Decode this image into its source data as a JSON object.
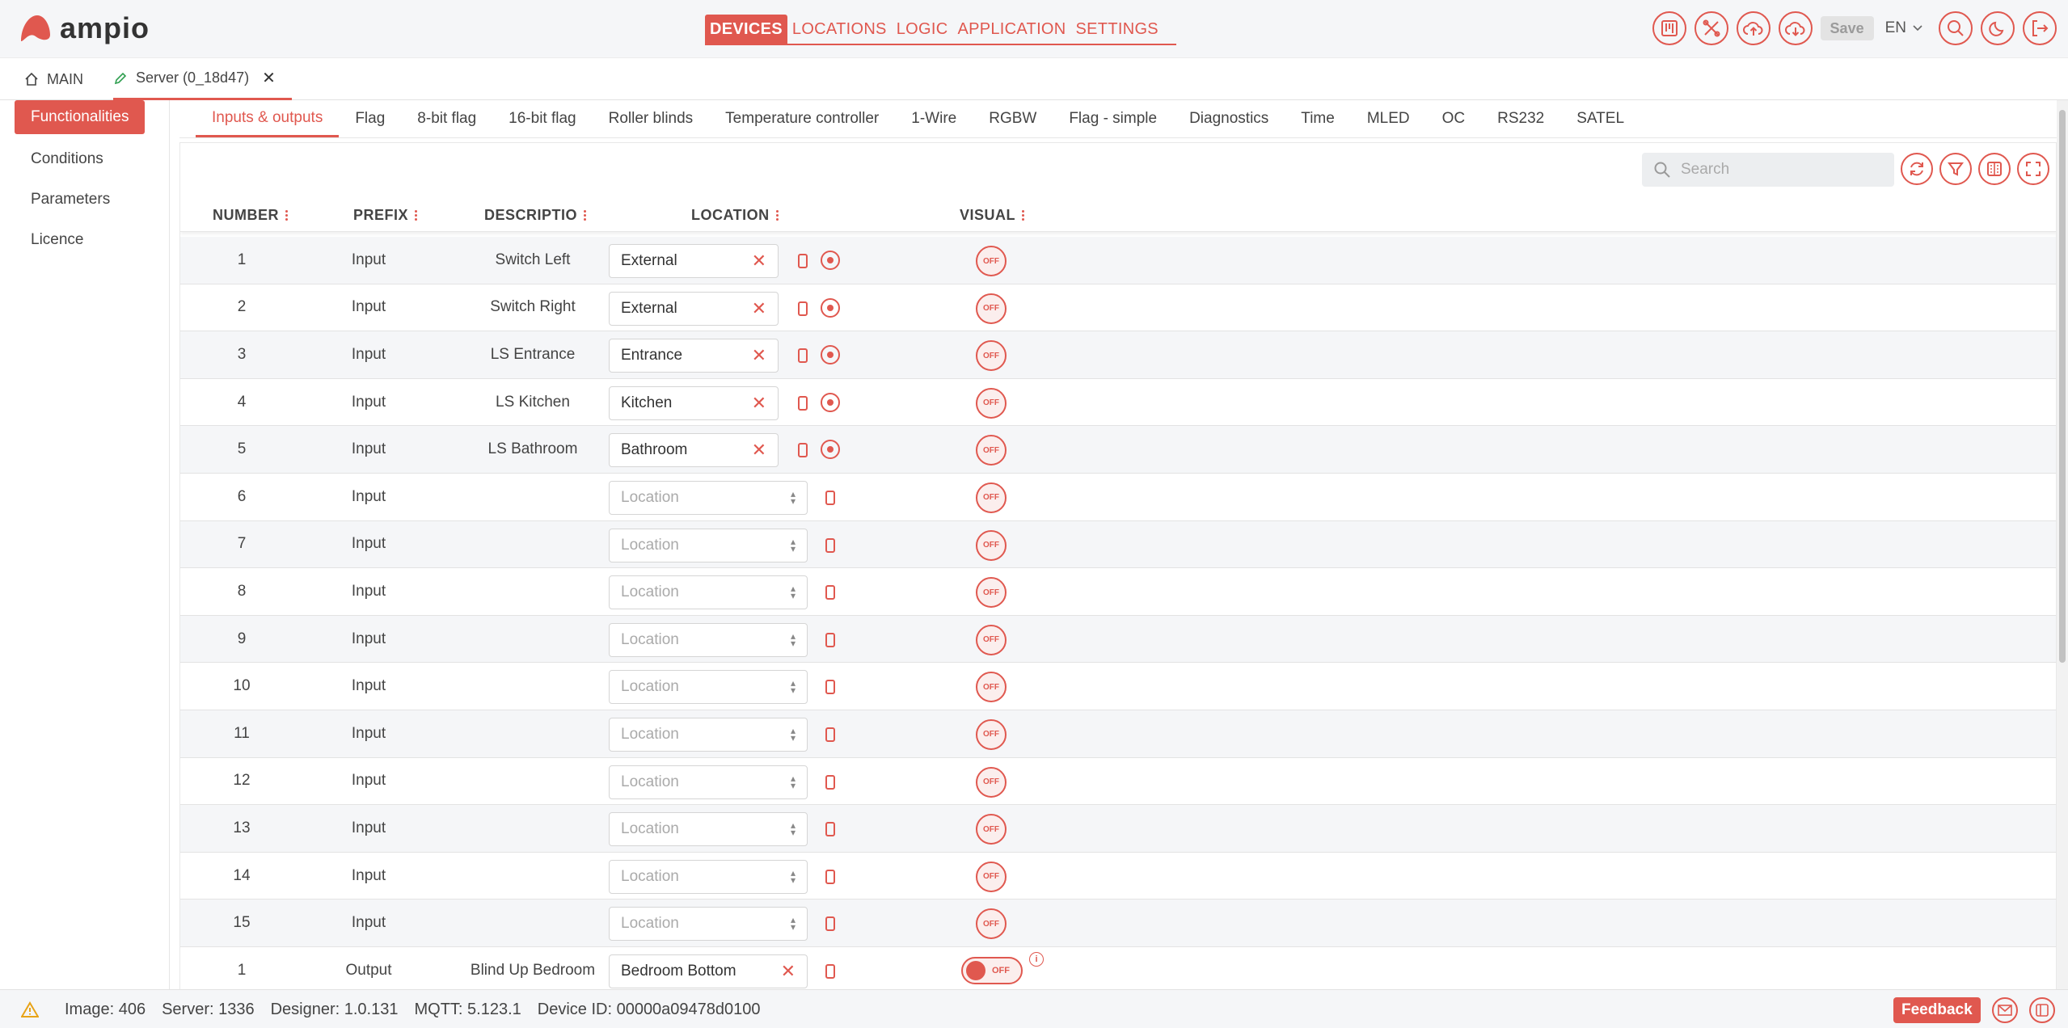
{
  "colors": {
    "accent": "#e0584f",
    "header_bg": "#f5f6f8",
    "stripe": "#f5f6f8"
  },
  "header": {
    "logo_text": "ampio",
    "nav": [
      {
        "label": "DEVICES",
        "active": true
      },
      {
        "label": "LOCATIONS",
        "active": false
      },
      {
        "label": "LOGIC",
        "active": false
      },
      {
        "label": "APPLICATION",
        "active": false
      },
      {
        "label": "SETTINGS",
        "active": false
      }
    ],
    "save_label": "Save",
    "language": "EN"
  },
  "page_tabs": {
    "main": "MAIN",
    "server": "Server (0_18d47)",
    "close": "✕"
  },
  "sidebar": {
    "items": [
      {
        "label": "Functionalities",
        "active": true
      },
      {
        "label": "Conditions",
        "active": false
      },
      {
        "label": "Parameters",
        "active": false
      },
      {
        "label": "Licence",
        "active": false
      }
    ]
  },
  "subtabs": [
    "Inputs & outputs",
    "Flag",
    "8-bit flag",
    "16-bit flag",
    "Roller blinds",
    "Temperature controller",
    "1-Wire",
    "RGBW",
    "Flag - simple",
    "Diagnostics",
    "Time",
    "MLED",
    "OC",
    "RS232",
    "SATEL"
  ],
  "search": {
    "placeholder": "Search"
  },
  "table": {
    "columns": {
      "number": "NUMBER",
      "prefix": "PREFIX",
      "description": "DESCRIPTIO",
      "location": "LOCATION",
      "visual": "VISUAL"
    },
    "location_placeholder": "Location",
    "off_label": "OFF",
    "rows": [
      {
        "number": "1",
        "prefix": "Input",
        "description": "Switch Left",
        "location": "External"
      },
      {
        "number": "2",
        "prefix": "Input",
        "description": "Switch Right",
        "location": "External"
      },
      {
        "number": "3",
        "prefix": "Input",
        "description": "LS Entrance",
        "location": "Entrance"
      },
      {
        "number": "4",
        "prefix": "Input",
        "description": "LS Kitchen",
        "location": "Kitchen"
      },
      {
        "number": "5",
        "prefix": "Input",
        "description": "LS Bathroom",
        "location": "Bathroom"
      },
      {
        "number": "6",
        "prefix": "Input",
        "description": "",
        "location": ""
      },
      {
        "number": "7",
        "prefix": "Input",
        "description": "",
        "location": ""
      },
      {
        "number": "8",
        "prefix": "Input",
        "description": "",
        "location": ""
      },
      {
        "number": "9",
        "prefix": "Input",
        "description": "",
        "location": ""
      },
      {
        "number": "10",
        "prefix": "Input",
        "description": "",
        "location": ""
      },
      {
        "number": "11",
        "prefix": "Input",
        "description": "",
        "location": ""
      },
      {
        "number": "12",
        "prefix": "Input",
        "description": "",
        "location": ""
      },
      {
        "number": "13",
        "prefix": "Input",
        "description": "",
        "location": ""
      },
      {
        "number": "14",
        "prefix": "Input",
        "description": "",
        "location": ""
      },
      {
        "number": "15",
        "prefix": "Input",
        "description": "",
        "location": ""
      },
      {
        "number": "1",
        "prefix": "Output",
        "description": "Blind Up Bedroom",
        "location": "Bedroom Bottom"
      }
    ]
  },
  "status": {
    "image": "Image: 406",
    "server": "Server: 1336",
    "designer": "Designer: 1.0.131",
    "mqtt": "MQTT: 5.123.1",
    "device_id": "Device ID: 00000a09478d0100",
    "feedback": "Feedback"
  }
}
